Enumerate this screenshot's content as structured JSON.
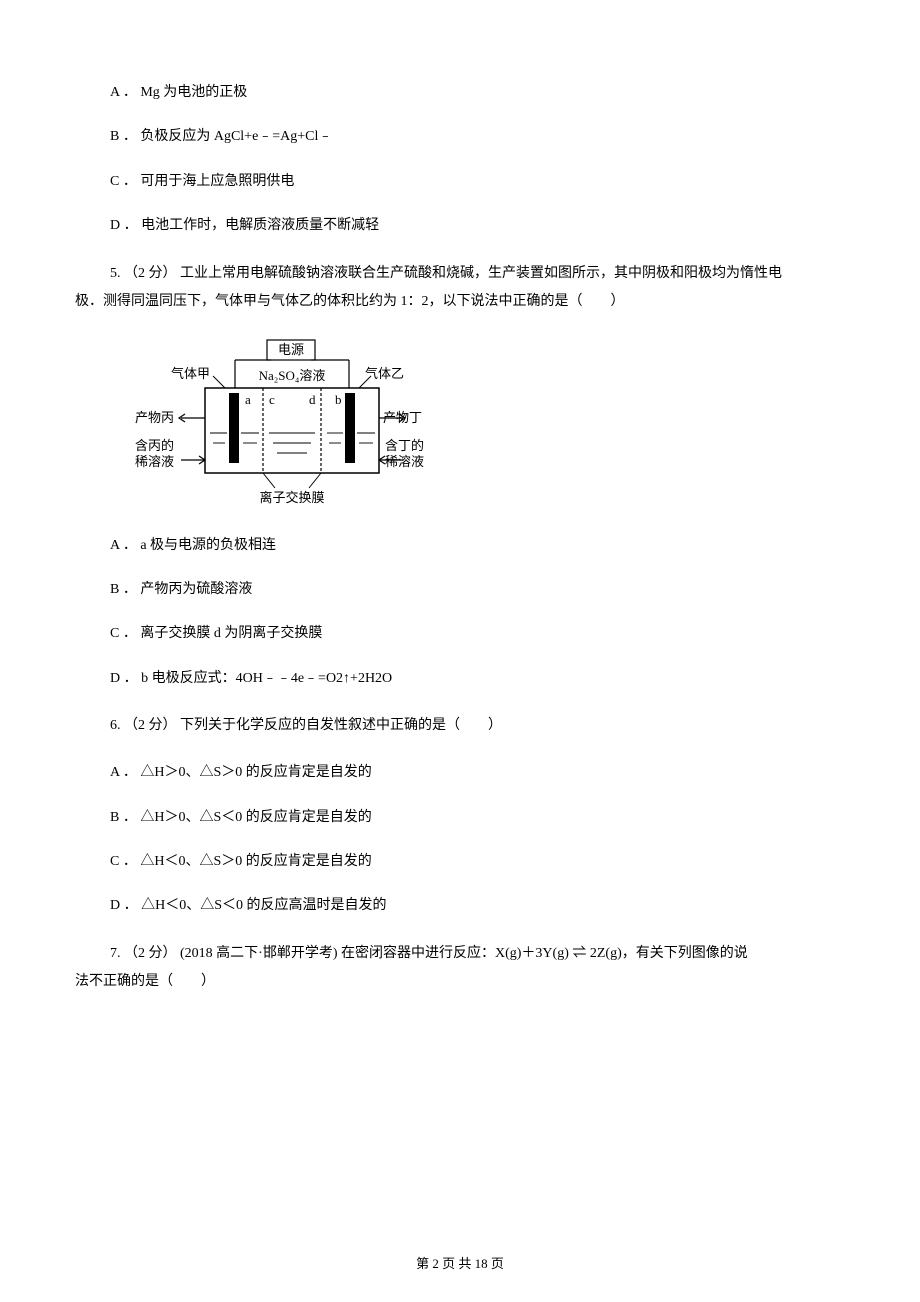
{
  "q4": {
    "options": {
      "a": "A ． Mg 为电池的正极",
      "b": "B ．  负极反应为 AgCl+e﹣=Ag+Cl﹣",
      "c": "C ． 可用于海上应急照明供电",
      "d": "D ． 电池工作时，电解质溶液质量不断减轻"
    }
  },
  "q5": {
    "stem_line1": "5. （2 分） 工业上常用电解硫酸钠溶液联合生产硫酸和烧碱，生产装置如图所示，其中阴极和阳极均为惰性电",
    "stem_line2": "极．测得同温同压下，气体甲与气体乙的体积比约为 1：2，以下说法中正确的是（　　）",
    "options": {
      "a": "A ． a 极与电源的负极相连",
      "b": "B ． 产物丙为硫酸溶液",
      "c": "C ． 离子交换膜 d 为阴离子交换膜",
      "d": "D ． b 电极反应式：4OH﹣﹣4e﹣=O2↑+2H2O"
    }
  },
  "diagram": {
    "power": "电源",
    "solution": "Na₂SO₄溶液",
    "gas_jia": "气体甲",
    "gas_yi": "气体乙",
    "prod_bing": "产物丙",
    "prod_ding": "产物丁",
    "dilute_bing_1": "含丙的",
    "dilute_bing_2": "稀溶液",
    "dilute_ding_1": "含丁的",
    "dilute_ding_2": "稀溶液",
    "membrane": "离子交换膜",
    "a": "a",
    "b": "b",
    "c": "c",
    "d": "d"
  },
  "q6": {
    "stem": "6. （2 分）  下列关于化学反应的自发性叙述中正确的是（　　）",
    "options": {
      "a": "A ． △H＞0、△S＞0 的反应肯定是自发的",
      "b": "B ． △H＞0、△S＜0 的反应肯定是自发的",
      "c": "C ． △H＜0、△S＞0 的反应肯定是自发的",
      "d": "D ． △H＜0、△S＜0 的反应高温时是自发的"
    }
  },
  "q7": {
    "stem_line1": "7. （2 分） (2018 高二下·邯郸开学考) 在密闭容器中进行反应：X(g)＋3Y(g) ⇌ 2Z(g)，有关下列图像的说",
    "stem_line2": "法不正确的是（　　）"
  },
  "footer": "第 2 页 共 18 页"
}
